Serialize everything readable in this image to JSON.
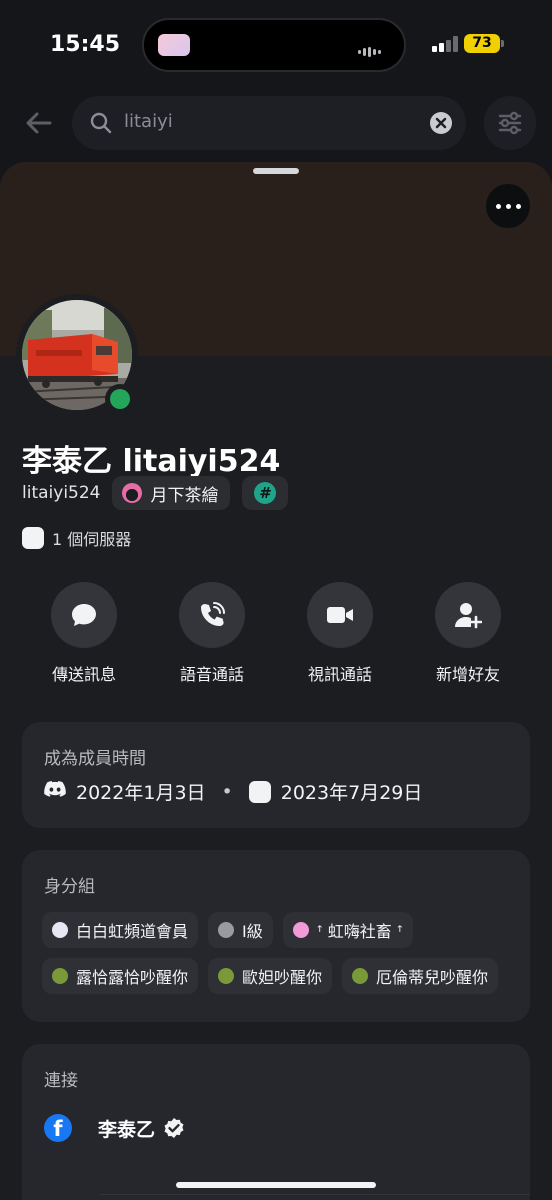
{
  "status_bar": {
    "time": "15:45",
    "battery": "73"
  },
  "search": {
    "query": "litaiyi"
  },
  "profile": {
    "display_name": "李泰乙 litaiyi524",
    "username": "litaiyi524",
    "server_tag": "月下茶繪",
    "hash_tag": "#",
    "servers_count": "1 個伺服器",
    "online_status_color": "#23a55a"
  },
  "actions": [
    {
      "label": "傳送訊息",
      "icon": "chat-bubble-icon"
    },
    {
      "label": "語音通話",
      "icon": "phone-icon"
    },
    {
      "label": "視訊通話",
      "icon": "video-camera-icon"
    },
    {
      "label": "新增好友",
      "icon": "add-friend-icon"
    }
  ],
  "member_since": {
    "title": "成為成員時間",
    "discord_date": "2022年1月3日",
    "separator": "•",
    "server_date": "2023年7月29日"
  },
  "roles": {
    "title": "身分組",
    "items": [
      {
        "label": "白白虹頻道會員",
        "color": "#e6e6f5"
      },
      {
        "label": "I級",
        "color": "#9a9ba0"
      },
      {
        "label": "ꜛ 虹嗨社畜 ꜛ",
        "color": "#f29ad8"
      },
      {
        "label": "露恰露恰吵醒你",
        "color": "#7a9a3a"
      },
      {
        "label": "歐妲吵醒你",
        "color": "#7a9a3a"
      },
      {
        "label": "厄倫蒂兒吵醒你",
        "color": "#7a9a3a"
      }
    ]
  },
  "connections": {
    "title": "連接",
    "items": [
      {
        "service": "facebook",
        "name": "李泰乙",
        "verified": true
      }
    ]
  },
  "colors": {
    "background": "#15161a",
    "sheet": "#1c1d21",
    "card": "#25272c",
    "banner": "#291f1b",
    "online": "#23a55a",
    "facebook": "#1877f2"
  }
}
